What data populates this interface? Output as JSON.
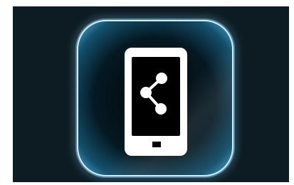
{
  "colors": {
    "background": "#0c1c22",
    "tile_glow": "#bfe6ff",
    "tile_fill_edge": "#1b4a66",
    "tile_fill_center": "#020608",
    "phone": "#ffffff",
    "screen": "#000000"
  },
  "icons": {
    "tile": "app-tile-icon",
    "phone": "smartphone-icon",
    "share": "share-icon",
    "home_button": "home-button-icon"
  }
}
